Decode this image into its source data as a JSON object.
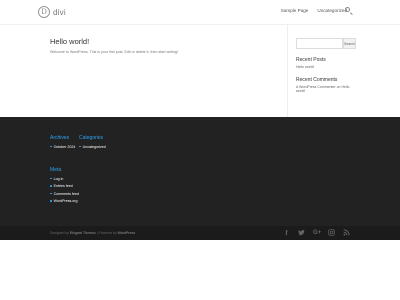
{
  "header": {
    "logo_mark": "D",
    "logo_text": "divi",
    "nav": [
      "Sample Page",
      "Uncategorized"
    ]
  },
  "post": {
    "title": "Hello world!",
    "text": "Welcome to WordPress. This is your first post. Edit or delete it, then start writing!"
  },
  "sidebar": {
    "search_button": "Search",
    "recent_posts_heading": "Recent Posts",
    "recent_posts": [
      "Hello world!"
    ],
    "recent_comments_heading": "Recent Comments",
    "recent_comment": "A WordPress Commenter on Hello world!"
  },
  "footer": {
    "archives_heading": "Archives",
    "archives": [
      "October 2024"
    ],
    "categories_heading": "Categories",
    "categories": [
      "Uncategorized"
    ],
    "meta_heading": "Meta",
    "meta": [
      "Log in",
      "Entries feed",
      "Comments feed",
      "WordPress.org"
    ]
  },
  "bottom": {
    "designed_by": "Designed by",
    "elegant": "Elegant Themes",
    "powered_by": "| Powered by",
    "wordpress": "WordPress"
  },
  "social": [
    "f",
    "t",
    "G+",
    "◎",
    "rss"
  ],
  "colors": {
    "accent": "#2ea3f2",
    "footer_bg": "#222222",
    "bottom_bg": "#1b1b1b"
  }
}
